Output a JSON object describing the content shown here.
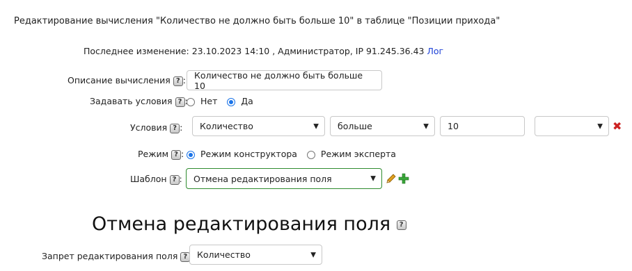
{
  "page": {
    "title": "Редактирование вычисления \"Количество не должно быть больше 10\" в таблице \"Позиции прихода\""
  },
  "last_change": {
    "text": "Последнее изменение: 23.10.2023 14:10 , Администратор, IP 91.245.36.43",
    "log_link": "Лог"
  },
  "form": {
    "help_glyph": "?",
    "description": {
      "label": "Описание вычисления",
      "value": "Количество не должно быть больше 10"
    },
    "set_conditions": {
      "label": "Задавать условия",
      "options": [
        "Нет",
        "Да"
      ],
      "selected": "Да"
    },
    "conditions": {
      "label": "Условия",
      "field": "Количество",
      "operator": "больше",
      "value": "10",
      "extra": ""
    },
    "mode": {
      "label": "Режим",
      "options": [
        "Режим конструктора",
        "Режим эксперта"
      ],
      "selected": "Режим конструктора"
    },
    "template": {
      "label": "Шаблон",
      "value": "Отмена редактирования поля"
    }
  },
  "section": {
    "heading": "Отмена редактирования поля",
    "field_lock": {
      "label": "Запрет редактирования поля",
      "value": "Количество"
    }
  },
  "colors": {
    "accent": "#1a73e8",
    "template_border": "#2e8b2e",
    "delete": "#cc2222",
    "add": "#3aa83a",
    "edit": "#e0a020"
  }
}
